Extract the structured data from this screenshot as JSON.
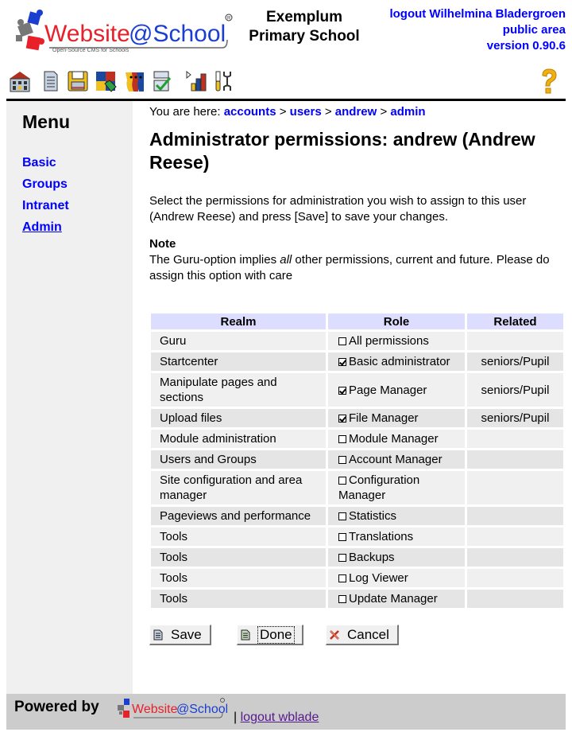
{
  "header": {
    "logo_text_main": "Website",
    "logo_text_at": "@School",
    "logo_subtitle": "Open-Source CMS for Schools",
    "school_name_line1": "Exemplum",
    "school_name_line2": "Primary School",
    "logout_link": "logout Wilhelmina Bladergroen",
    "area_link": "public area",
    "version": "version 0.90.6"
  },
  "toolbar": {
    "items": [
      {
        "icon": "home-icon",
        "label": "Start center"
      },
      {
        "icon": "page-icon",
        "label": "Page manager"
      },
      {
        "icon": "floppy-icon",
        "label": "File manager"
      },
      {
        "icon": "puzzle-icon",
        "label": "Module manager"
      },
      {
        "icon": "users-icon",
        "label": "Account manager"
      },
      {
        "icon": "checklist-icon",
        "label": "Configuration manager"
      },
      {
        "icon": "statistics-icon",
        "label": "Statistics"
      },
      {
        "icon": "tools-icon",
        "label": "Tools"
      }
    ],
    "help_icon": "help-icon"
  },
  "sidebar": {
    "title": "Menu",
    "items": [
      {
        "label": "Basic",
        "active": false
      },
      {
        "label": "Groups",
        "active": false
      },
      {
        "label": "Intranet",
        "active": false
      },
      {
        "label": "Admin",
        "active": true
      }
    ]
  },
  "breadcrumb": {
    "prefix": "You are here: ",
    "items": [
      "accounts",
      "users",
      "andrew",
      "admin"
    ],
    "separator": " > "
  },
  "main": {
    "title": "Administrator permissions: andrew (Andrew Reese)",
    "intro": "Select the permissions for administration you wish to assign to this user (Andrew Reese) and press [Save] to save your changes.",
    "note_heading": "Note",
    "note_before": "The Guru-option implies ",
    "note_emph": "all",
    "note_after": " other permissions, current and future. Please do assign this option with care"
  },
  "table": {
    "headers": [
      "Realm",
      "Role",
      "Related"
    ],
    "rows": [
      {
        "realm": "Guru",
        "role": "All permissions",
        "checked": false,
        "related": ""
      },
      {
        "realm": "Startcenter",
        "role": "Basic administrator",
        "checked": true,
        "related": "seniors/Pupil"
      },
      {
        "realm": "Manipulate pages and sections",
        "role": "Page Manager",
        "checked": true,
        "related": "seniors/Pupil"
      },
      {
        "realm": "Upload files",
        "role": "File Manager",
        "checked": true,
        "related": "seniors/Pupil"
      },
      {
        "realm": "Module administration",
        "role": "Module Manager",
        "checked": false,
        "related": ""
      },
      {
        "realm": "Users and Groups",
        "role": "Account Manager",
        "checked": false,
        "related": ""
      },
      {
        "realm": "Site configuration and area manager",
        "role": "Configuration Manager",
        "checked": false,
        "related": ""
      },
      {
        "realm": "Pageviews and performance",
        "role": "Statistics",
        "checked": false,
        "related": ""
      },
      {
        "realm": "Tools",
        "role": "Translations",
        "checked": false,
        "related": ""
      },
      {
        "realm": "Tools",
        "role": "Backups",
        "checked": false,
        "related": ""
      },
      {
        "realm": "Tools",
        "role": "Log Viewer",
        "checked": false,
        "related": ""
      },
      {
        "realm": "Tools",
        "role": "Update Manager",
        "checked": false,
        "related": ""
      }
    ]
  },
  "buttons": {
    "save": "Save",
    "done": "Done",
    "cancel": "Cancel"
  },
  "footer": {
    "powered_by": "Powered by",
    "logo_text_main": "Website",
    "logo_text_at": "@School",
    "separator": "| ",
    "logout_link": "logout wblade"
  },
  "colors": {
    "link": "#0000ff",
    "visited_link": "#551a8b",
    "table_header": "#ddddff",
    "sidebar_bg": "#f0f0f0",
    "footer_bg": "#cccccc",
    "logo_red": "#e8202a",
    "logo_blue": "#1a3fd0"
  }
}
